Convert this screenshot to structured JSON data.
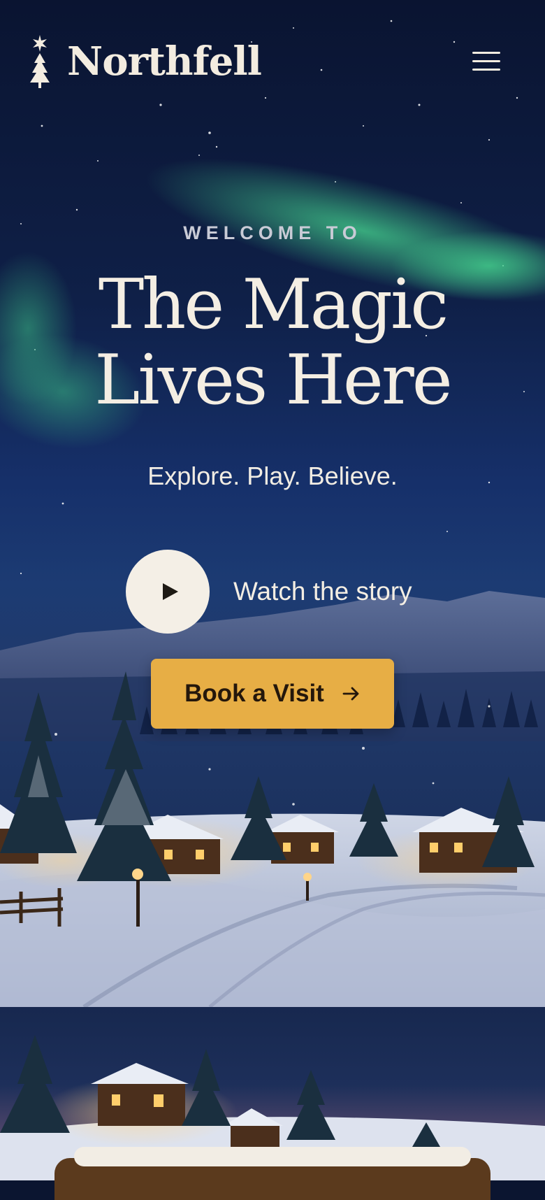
{
  "brand": {
    "name": "Northfell",
    "logo_icon": "star-tree-icon"
  },
  "header": {
    "menu_icon": "hamburger-menu-icon"
  },
  "hero": {
    "eyebrow": "WELCOME TO",
    "headline_line1": "The Magic",
    "headline_line2": "Lives Here",
    "tagline": "Explore. Play. Believe.",
    "watch_label": "Watch the story",
    "watch_icon": "play-icon",
    "cta_label": "Book a Visit",
    "cta_icon": "arrow-right-icon"
  },
  "colors": {
    "sky_dark": "#0a1431",
    "aurora": "#3fcf8a",
    "cream": "#f4eee3",
    "cta": "#e7ae45",
    "cta_text": "#24170b",
    "sheet": "#5b3a1d"
  }
}
